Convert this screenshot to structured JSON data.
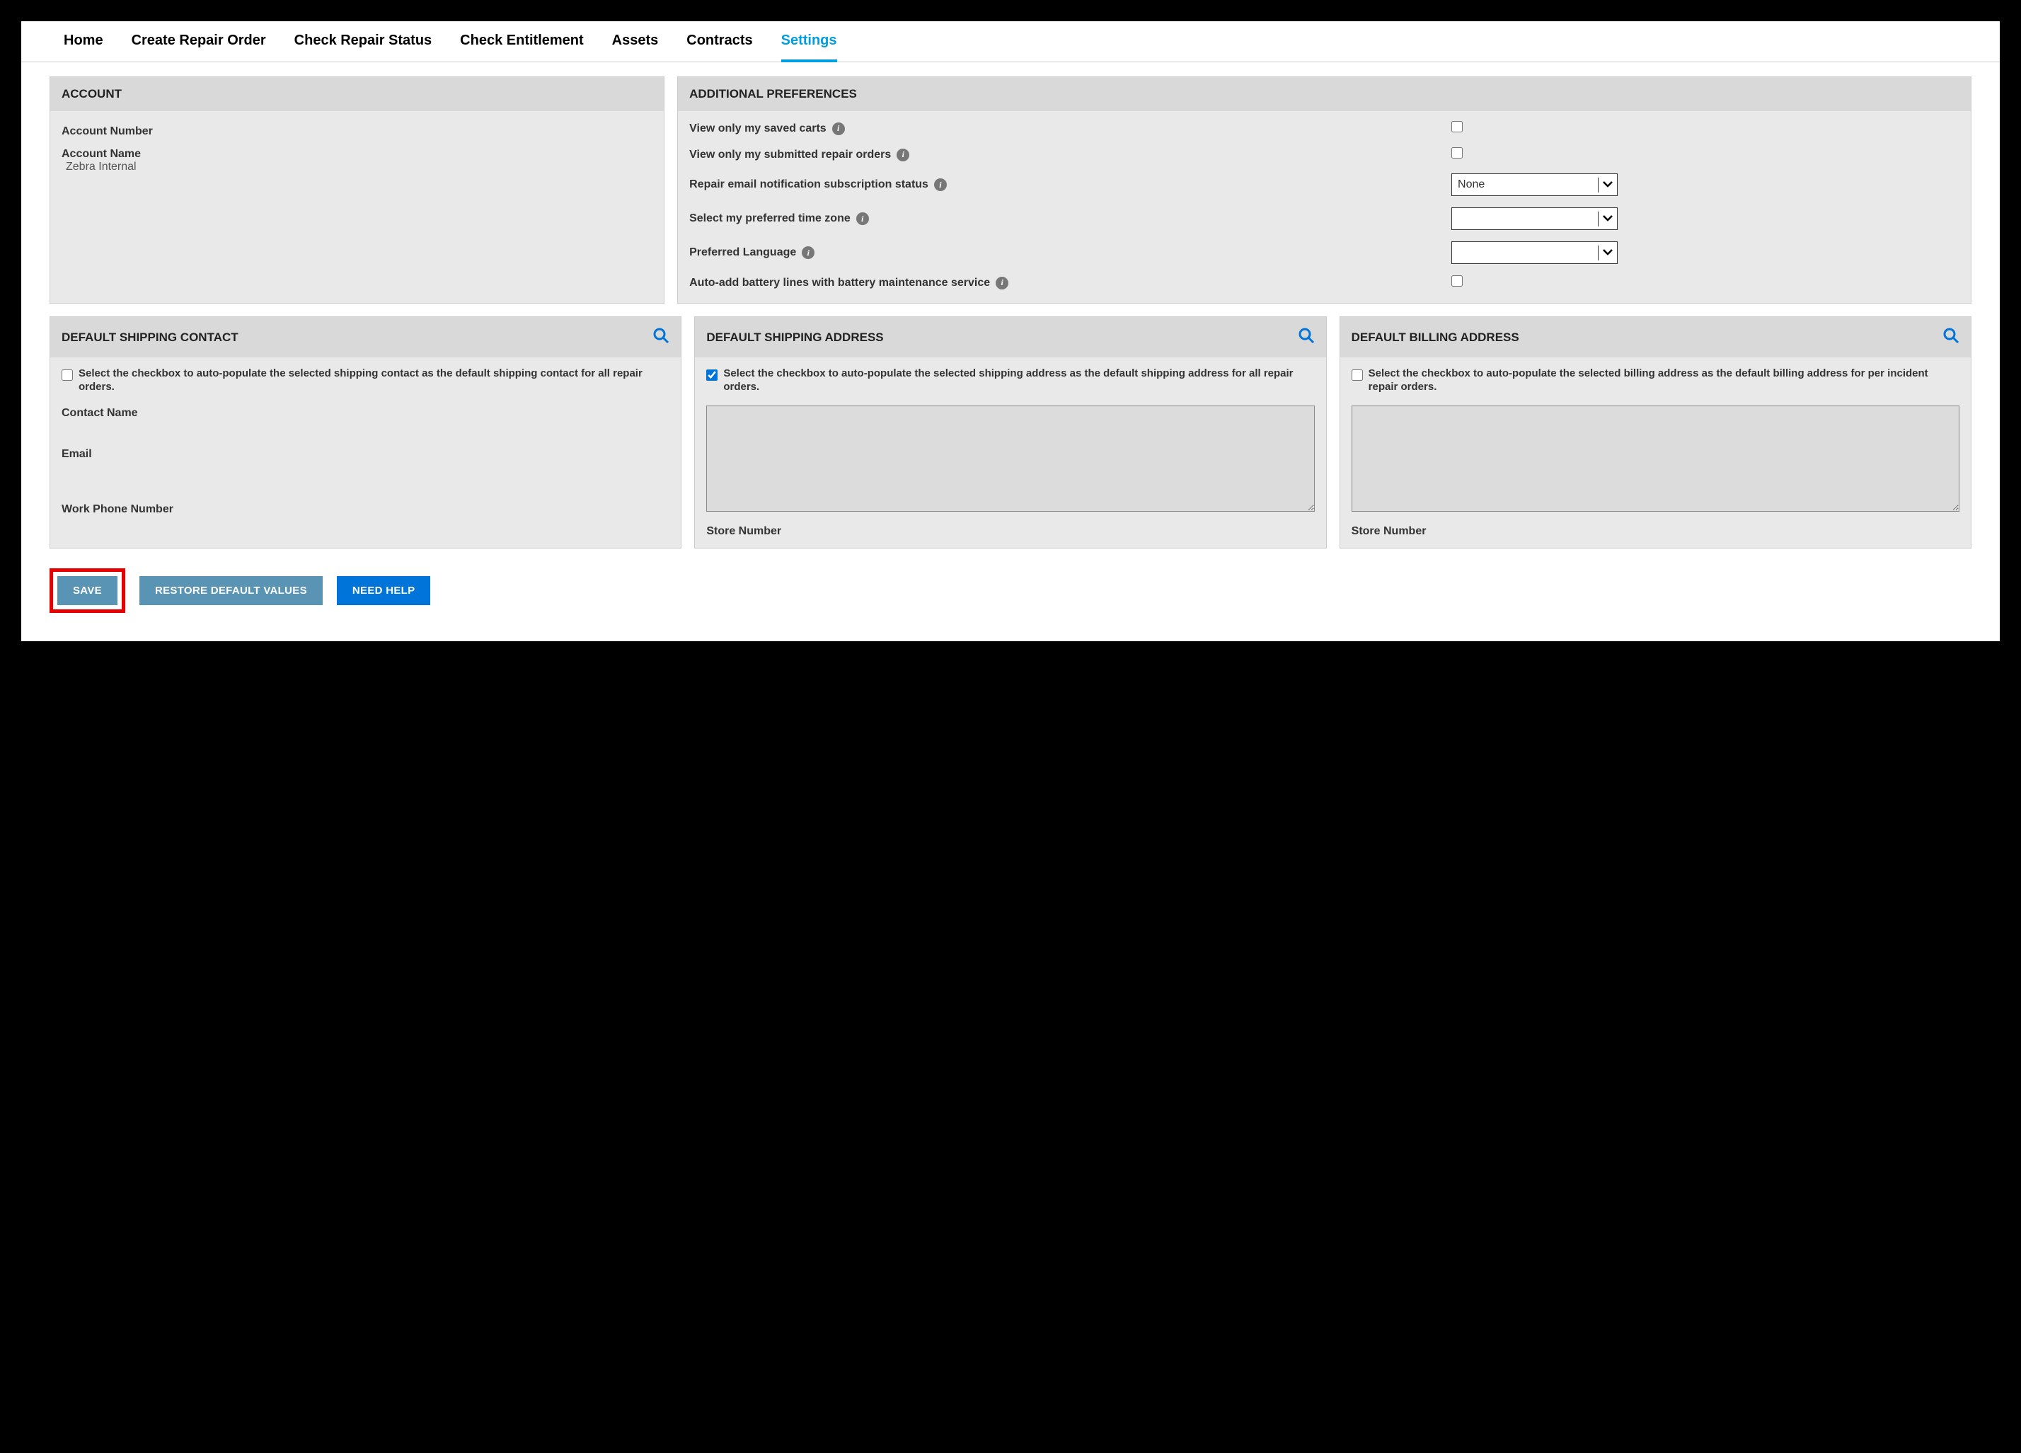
{
  "nav": {
    "items": [
      {
        "label": "Home"
      },
      {
        "label": "Create Repair Order"
      },
      {
        "label": "Check Repair Status"
      },
      {
        "label": "Check Entitlement"
      },
      {
        "label": "Assets"
      },
      {
        "label": "Contracts"
      },
      {
        "label": "Settings"
      }
    ]
  },
  "account": {
    "title": "ACCOUNT",
    "number_label": "Account Number",
    "number_value": "",
    "name_label": "Account Name",
    "name_value": "Zebra Internal"
  },
  "prefs": {
    "title": "ADDITIONAL PREFERENCES",
    "rows": {
      "saved_carts_label": "View only my saved carts",
      "submitted_orders_label": "View only my submitted repair orders",
      "email_notif_label": "Repair email notification subscription status",
      "email_notif_value": "None",
      "timezone_label": "Select my preferred time zone",
      "timezone_value": "",
      "language_label": "Preferred Language",
      "language_value": "",
      "battery_label": "Auto-add battery lines with battery maintenance service"
    }
  },
  "ship_contact": {
    "title": "DEFAULT SHIPPING CONTACT",
    "desc": "Select the checkbox to auto-populate the selected shipping contact as the default shipping contact for all repair orders.",
    "contact_name_label": "Contact Name",
    "email_label": "Email",
    "phone_label": "Work Phone Number"
  },
  "ship_address": {
    "title": "DEFAULT SHIPPING ADDRESS",
    "desc": "Select the checkbox to auto-populate the selected shipping address as the default shipping address for all repair orders.",
    "store_label": "Store Number"
  },
  "bill_address": {
    "title": "DEFAULT BILLING ADDRESS",
    "desc": "Select the checkbox to auto-populate the selected billing address as the default billing address for per incident repair orders.",
    "store_label": "Store Number"
  },
  "buttons": {
    "save": "SAVE",
    "restore": "RESTORE DEFAULT VALUES",
    "help": "NEED HELP"
  }
}
